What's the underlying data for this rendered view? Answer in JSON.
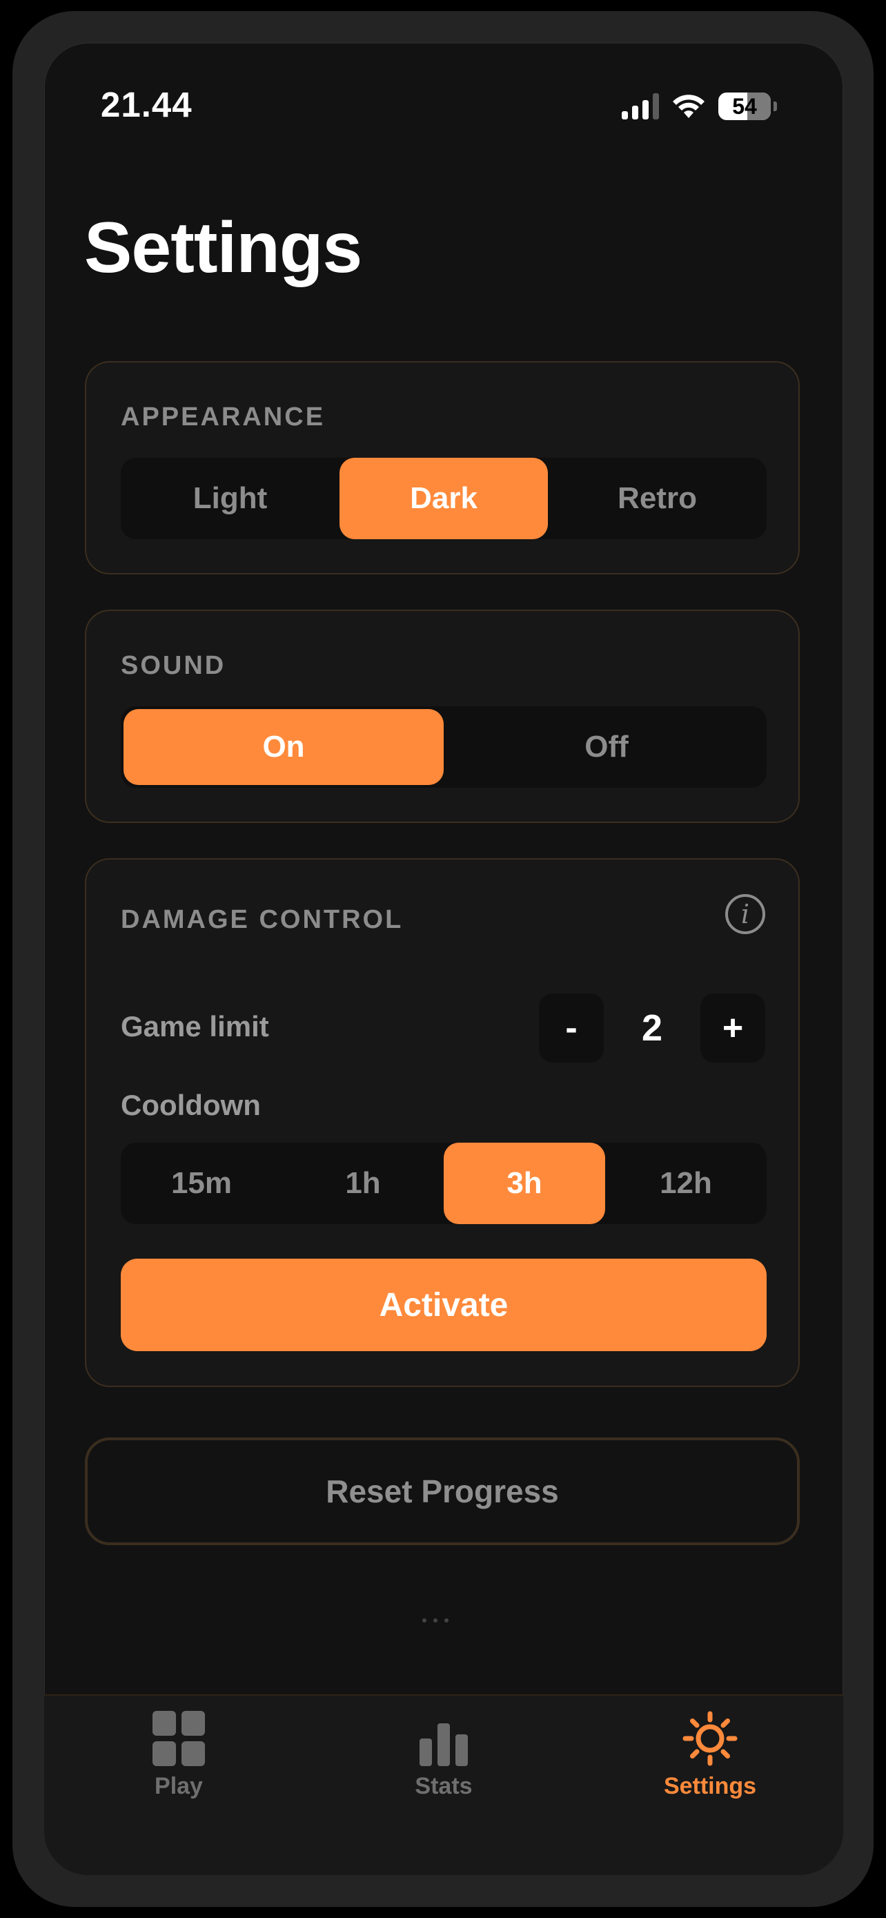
{
  "status_bar": {
    "time": "21.44",
    "battery": "54"
  },
  "page": {
    "title": "Settings"
  },
  "appearance": {
    "label": "APPEARANCE",
    "options": [
      "Light",
      "Dark",
      "Retro"
    ],
    "selected": "Dark"
  },
  "sound": {
    "label": "SOUND",
    "options": [
      "On",
      "Off"
    ],
    "selected": "On"
  },
  "damage_control": {
    "label": "DAMAGE CONTROL",
    "info_icon": "i",
    "game_limit": {
      "label": "Game limit",
      "decrement": "-",
      "value": "2",
      "increment": "+"
    },
    "cooldown": {
      "label": "Cooldown",
      "options": [
        "15m",
        "1h",
        "3h",
        "12h"
      ],
      "selected": "3h"
    },
    "activate_label": "Activate"
  },
  "reset_label": "Reset Progress",
  "tabs": [
    {
      "label": "Play",
      "icon": "grid-icon"
    },
    {
      "label": "Stats",
      "icon": "bar-chart-icon"
    },
    {
      "label": "Settings",
      "icon": "sun-icon"
    }
  ],
  "colors": {
    "accent": "#ff8a3b",
    "background": "#121212",
    "card_border": "#3b2e1f"
  }
}
